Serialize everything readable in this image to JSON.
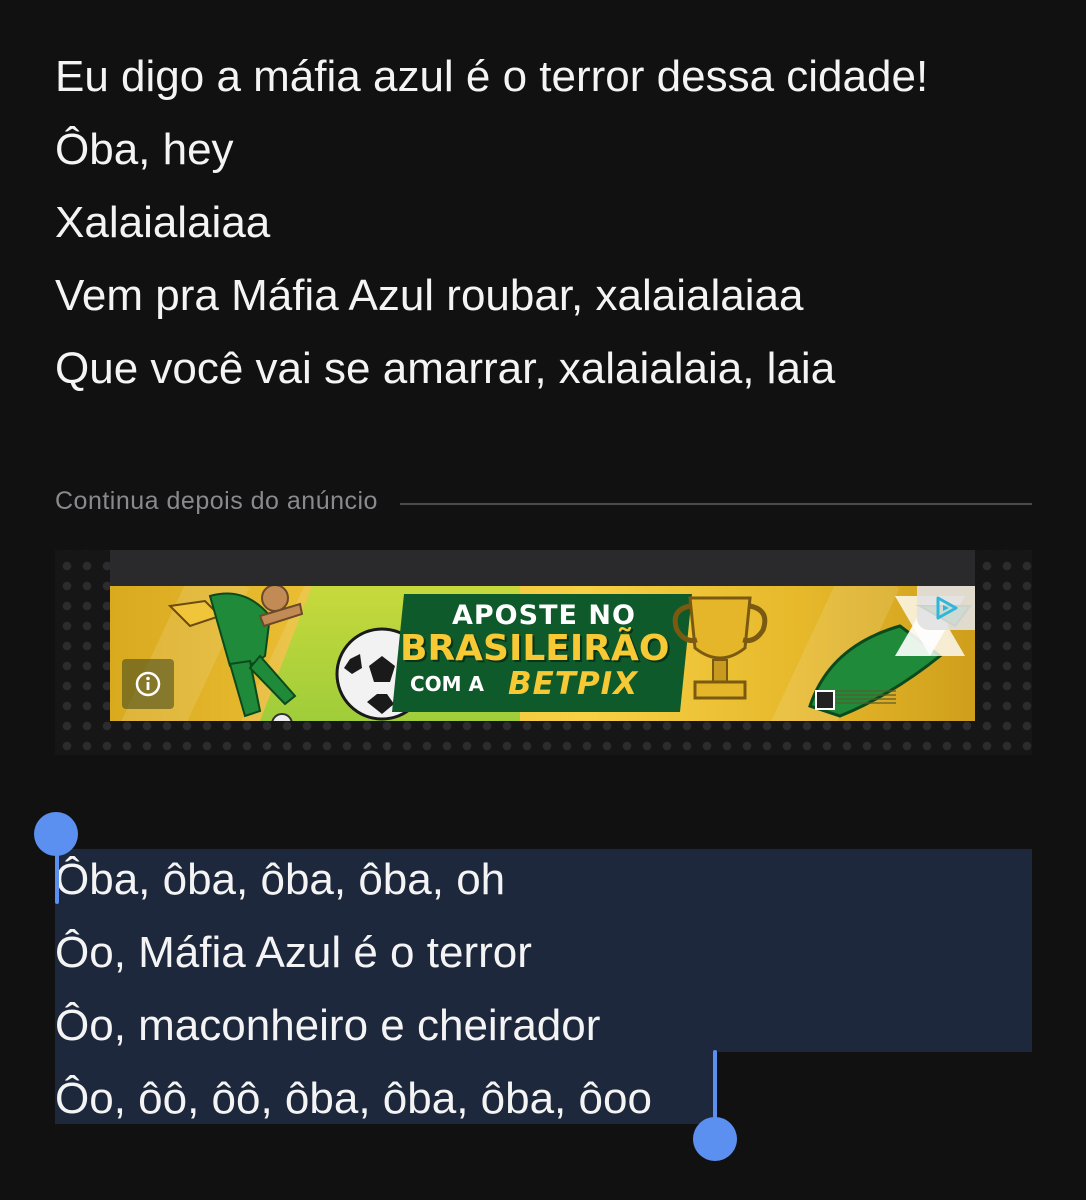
{
  "lyrics_top": [
    "Eu digo a máfia azul é o terror dessa cidade!",
    "Ôba, hey",
    "Xalaialaiaa",
    "Vem pra Máfia Azul roubar, xalaialaiaa",
    "Que você vai se amarrar, xalaialaia, laia"
  ],
  "ad": {
    "divider_label": "Continua depois do anúncio",
    "banner_line1": "APOSTE NO",
    "banner_line2": "BRASILEIRÃO",
    "banner_line3": "COM A",
    "banner_brand": "BETPIX",
    "info_icon": "info-icon",
    "adchoices_icon": "adchoices-icon",
    "colors": {
      "banner_yellow": "#f0c43a",
      "banner_green": "#0f5a2a"
    }
  },
  "lyrics_selected": [
    "Ôba, ôba, ôba, ôba, oh",
    "Ôo, Máfia Azul é o terror",
    "Ôo, maconheiro e cheirador",
    "Ôo, ôô, ôô, ôba, ôba, ôba, ôoo"
  ],
  "selection": {
    "handle_color": "#5b8ff0",
    "highlight_color": "#1e283c"
  }
}
